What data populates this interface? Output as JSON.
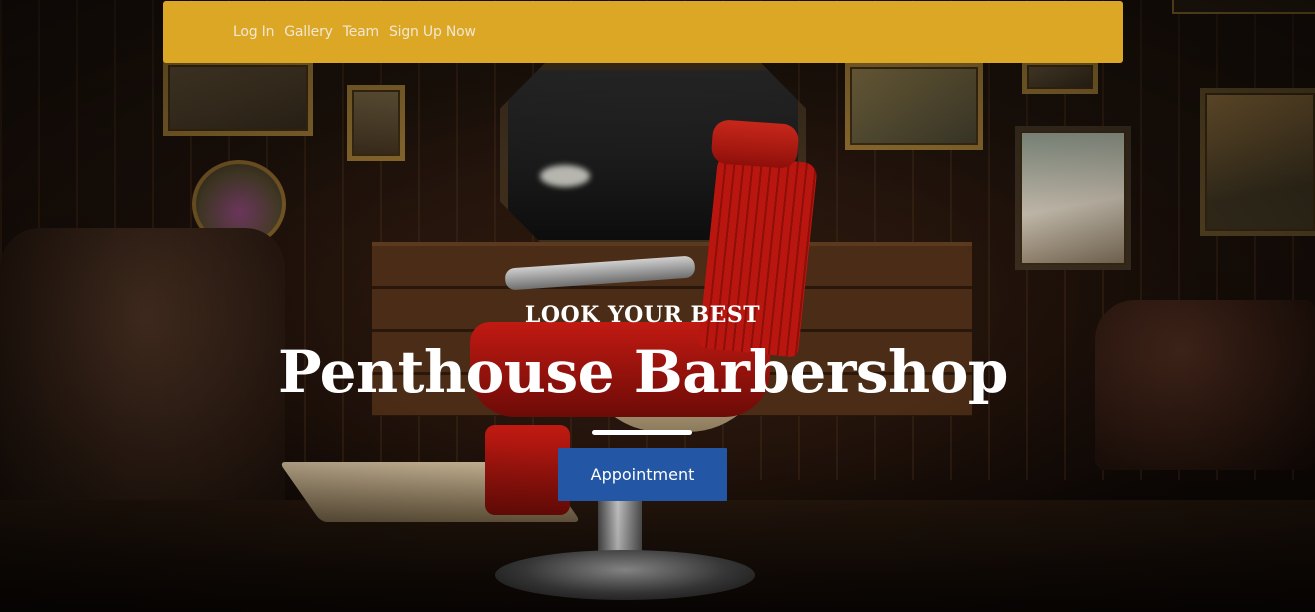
{
  "nav": {
    "links": [
      {
        "label": "Log In"
      },
      {
        "label": "Gallery"
      },
      {
        "label": "Team"
      },
      {
        "label": "Sign Up Now"
      }
    ]
  },
  "hero": {
    "tagline": "LOOK YOUR BEST",
    "headline": "Penthouse Barbershop",
    "cta_label": "Appointment",
    "background_image": "barbershop-interior-with-red-barber-chair"
  },
  "colors": {
    "navbar": "#dda726",
    "nav_text": "#f1e7d1",
    "button": "#2456a6",
    "text": "#ffffff"
  }
}
